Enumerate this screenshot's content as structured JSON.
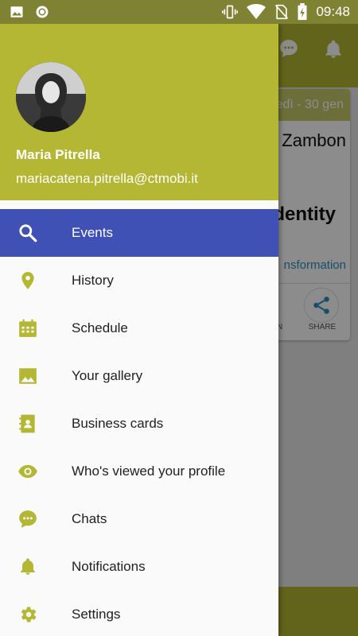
{
  "status_bar": {
    "time": "09:48",
    "left_icons": [
      "image-icon",
      "record-icon"
    ],
    "right_icons": [
      "vibrate-icon",
      "wifi-icon",
      "no-sim-icon",
      "battery-charging-icon"
    ]
  },
  "profile": {
    "name": "Maria Pitrella",
    "email": "mariacatena.pitrella@ctmobi.it"
  },
  "menu": {
    "items": [
      {
        "label": "Events",
        "icon": "search-icon",
        "active": true
      },
      {
        "label": "History",
        "icon": "location-pin-icon",
        "active": false
      },
      {
        "label": "Schedule",
        "icon": "calendar-icon",
        "active": false
      },
      {
        "label": "Your gallery",
        "icon": "image-icon",
        "active": false
      },
      {
        "label": "Business cards",
        "icon": "contact-book-icon",
        "active": false
      },
      {
        "label": "Who's viewed your profile",
        "icon": "eye-icon",
        "active": false
      },
      {
        "label": "Chats",
        "icon": "chat-bubble-icon",
        "active": false
      },
      {
        "label": "Notifications",
        "icon": "bell-icon",
        "active": false
      },
      {
        "label": "Settings",
        "icon": "gear-icon",
        "active": false
      }
    ]
  },
  "background": {
    "card_date": "edì - 30 gen",
    "card_speaker": "Zambon",
    "card_title": "dentity",
    "card_link": "nsformation",
    "card_partial_label": "N",
    "share_label": "SHARE"
  },
  "colors": {
    "accent": "#b3b733",
    "active_item": "#3f51b5",
    "status_bar": "#7f8233",
    "link": "#2a8fbd"
  }
}
